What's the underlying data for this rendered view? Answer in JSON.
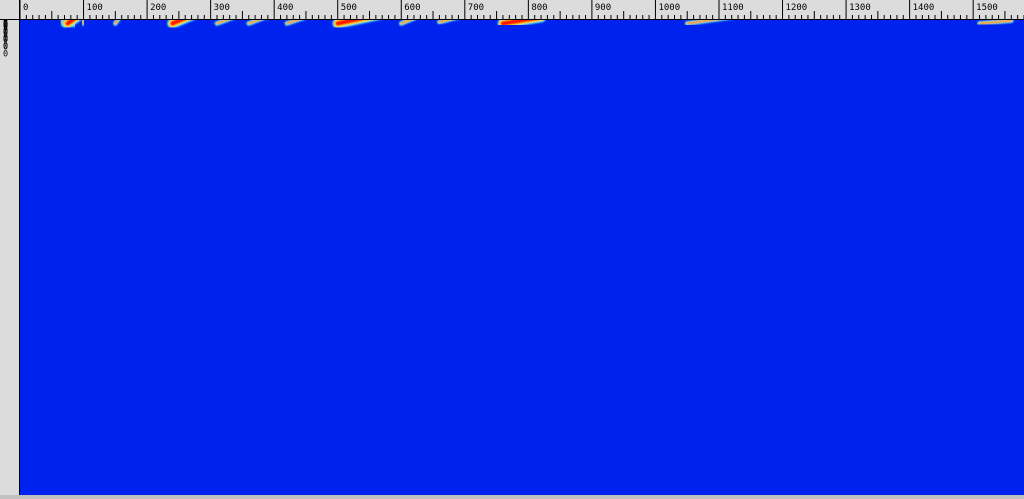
{
  "colors": {
    "background": "#0022ee",
    "low": "#00d8ff",
    "mid": "#ffee00",
    "high": "#ff1500",
    "ruler": "#dcdcdc"
  },
  "chart_data": {
    "type": "heatmap",
    "title": "",
    "xlabel": "",
    "ylabel": "",
    "colormap": "jet",
    "x_range": [
      0,
      1580
    ],
    "y_range": [
      8600,
      1750
    ],
    "x_ticks": [
      "0",
      "100",
      "200",
      "300",
      "400",
      "500",
      "600",
      "700",
      "800",
      "900",
      "1000",
      "1100",
      "1200",
      "1300",
      "1400",
      "1500"
    ],
    "y_ticks": [
      "1700",
      "1600",
      "1500",
      "1400",
      "1300",
      "1200",
      "1100",
      "1000",
      "900"
    ],
    "y_tick_values": [
      1700,
      1600,
      1500,
      1400,
      1300,
      1200,
      1100,
      1000,
      900
    ],
    "horizontal_event": {
      "y": 1530,
      "x_start": 60,
      "x_end": 960
    },
    "traces": [
      {
        "x0": 70,
        "y0": 1800,
        "x1": 65,
        "y1": 850,
        "intensity": "mid"
      },
      {
        "x0": 85,
        "y0": 1800,
        "x1": 80,
        "y1": 850,
        "intensity": "mid"
      },
      {
        "x0": 100,
        "y0": 1800,
        "x1": 98,
        "y1": 850,
        "intensity": "low"
      },
      {
        "x0": 75,
        "y0": 1800,
        "x1": 115,
        "y1": 1540,
        "intensity": "high"
      },
      {
        "x0": 150,
        "y0": 1800,
        "x1": 170,
        "y1": 1530,
        "intensity": "low"
      },
      {
        "x0": 240,
        "y0": 1800,
        "x1": 310,
        "y1": 1530,
        "intensity": "high"
      },
      {
        "x0": 280,
        "y0": 1600,
        "x1": 310,
        "y1": 1530,
        "intensity": "mid"
      },
      {
        "x0": 310,
        "y0": 1800,
        "x1": 390,
        "y1": 1530,
        "intensity": "low"
      },
      {
        "x0": 360,
        "y0": 1800,
        "x1": 440,
        "y1": 1530,
        "intensity": "low"
      },
      {
        "x0": 420,
        "y0": 1800,
        "x1": 500,
        "y1": 1550,
        "intensity": "low"
      },
      {
        "x0": 500,
        "y0": 1800,
        "x1": 640,
        "y1": 1530,
        "intensity": "high"
      },
      {
        "x0": 560,
        "y0": 1650,
        "x1": 620,
        "y1": 1520,
        "intensity": "mid"
      },
      {
        "x0": 600,
        "y0": 1800,
        "x1": 670,
        "y1": 1540,
        "intensity": "low"
      },
      {
        "x0": 660,
        "y0": 1780,
        "x1": 720,
        "y1": 1640,
        "intensity": "low"
      },
      {
        "x0": 760,
        "y0": 1800,
        "x1": 820,
        "y1": 1710,
        "intensity": "high"
      },
      {
        "x0": 820,
        "y0": 1680,
        "x1": 940,
        "y1": 1530,
        "intensity": "high"
      },
      {
        "x0": 1050,
        "y0": 1800,
        "x1": 1120,
        "y1": 1710,
        "intensity": "low"
      },
      {
        "x0": 1330,
        "y0": 1740,
        "x1": 1390,
        "y1": 1700,
        "intensity": "low"
      },
      {
        "x0": 1460,
        "y0": 1640,
        "x1": 1560,
        "y1": 1580,
        "intensity": "low"
      },
      {
        "x0": 1510,
        "y0": 1800,
        "x1": 1560,
        "y1": 1760,
        "intensity": "low"
      },
      {
        "x0": 1040,
        "y0": 1520,
        "x1": 1060,
        "y1": 1460,
        "intensity": "low"
      },
      {
        "x0": 230,
        "y0": 1530,
        "x1": 310,
        "y1": 850,
        "intensity": "high"
      },
      {
        "x0": 170,
        "y0": 1520,
        "x1": 200,
        "y1": 850,
        "intensity": "low"
      },
      {
        "x0": 290,
        "y0": 1510,
        "x1": 360,
        "y1": 850,
        "intensity": "low"
      },
      {
        "x0": 340,
        "y0": 1520,
        "x1": 420,
        "y1": 850,
        "intensity": "low"
      },
      {
        "x0": 420,
        "y0": 1500,
        "x1": 470,
        "y1": 870,
        "intensity": "mid"
      },
      {
        "x0": 470,
        "y0": 1500,
        "x1": 560,
        "y1": 850,
        "intensity": "low"
      },
      {
        "x0": 520,
        "y0": 1510,
        "x1": 620,
        "y1": 850,
        "intensity": "high"
      },
      {
        "x0": 570,
        "y0": 1510,
        "x1": 670,
        "y1": 870,
        "intensity": "low"
      },
      {
        "x0": 610,
        "y0": 1520,
        "x1": 730,
        "y1": 880,
        "intensity": "mid"
      },
      {
        "x0": 650,
        "y0": 1500,
        "x1": 710,
        "y1": 1300,
        "intensity": "low"
      },
      {
        "x0": 790,
        "y0": 1520,
        "x1": 950,
        "y1": 850,
        "intensity": "high"
      },
      {
        "x0": 920,
        "y0": 1500,
        "x1": 980,
        "y1": 1300,
        "intensity": "low"
      },
      {
        "x0": 960,
        "y0": 1300,
        "x1": 1010,
        "y1": 1130,
        "intensity": "low"
      },
      {
        "x0": 1130,
        "y0": 1180,
        "x1": 1280,
        "y1": 850,
        "intensity": "mid"
      },
      {
        "x0": 1210,
        "y0": 1280,
        "x1": 1250,
        "y1": 1220,
        "intensity": "low"
      },
      {
        "x0": 1310,
        "y0": 1500,
        "x1": 1580,
        "y1": 890,
        "intensity": "mid"
      },
      {
        "x0": 1300,
        "y0": 1250,
        "x1": 1480,
        "y1": 860,
        "intensity": "low"
      },
      {
        "x0": 1460,
        "y0": 1470,
        "x1": 1560,
        "y1": 1270,
        "intensity": "low"
      },
      {
        "x0": 1490,
        "y0": 1500,
        "x1": 1560,
        "y1": 1380,
        "intensity": "low"
      },
      {
        "x0": 1520,
        "y0": 1230,
        "x1": 1580,
        "y1": 1120,
        "intensity": "low"
      }
    ]
  }
}
